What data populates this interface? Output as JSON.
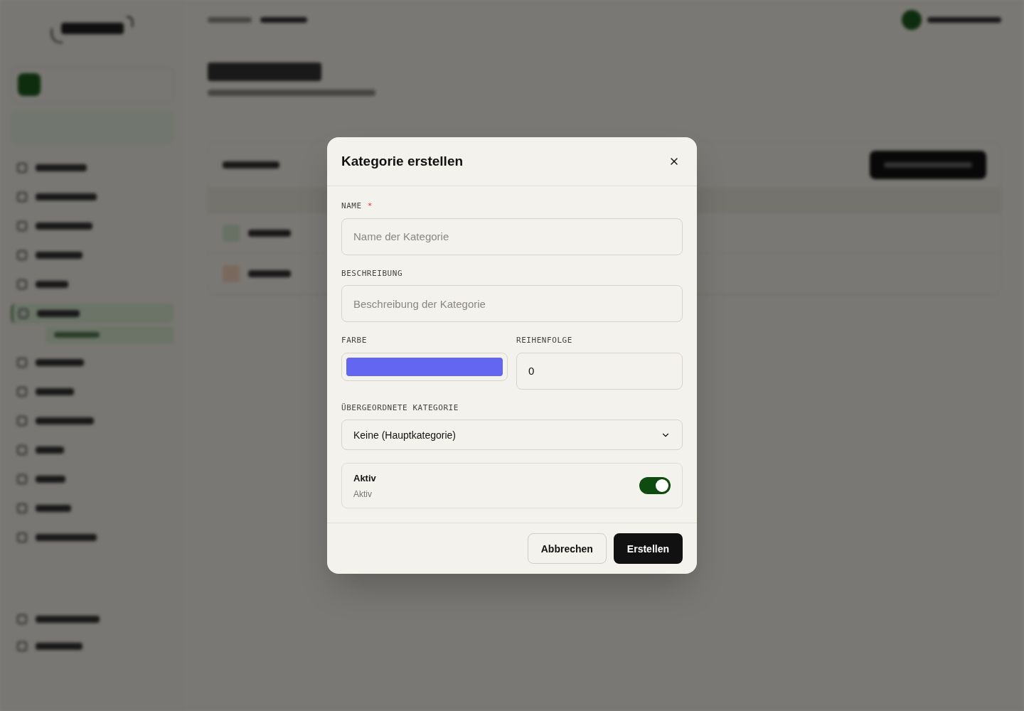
{
  "dialog": {
    "title": "Kategorie erstellen",
    "fields": [
      {
        "kind": "text",
        "label": "NAME",
        "required": true,
        "required_mark": "*",
        "placeholder": "Name der Kategorie"
      },
      {
        "kind": "text",
        "label": "BESCHREIBUNG",
        "placeholder": "Beschreibung der Kategorie"
      }
    ],
    "color_field": {
      "label": "FARBE",
      "color": "#6366f1"
    },
    "order_field": {
      "label": "REIHENFOLGE",
      "value": "0"
    },
    "parent_field": {
      "label": "ÜBERGEORDNETE KATEGORIE",
      "value": "Keine (Hauptkategorie)"
    },
    "active": {
      "title": "Aktiv",
      "description": "Aktiv",
      "on": true
    },
    "buttons": {
      "cancel": "Abbrechen",
      "submit": "Erstellen"
    }
  }
}
